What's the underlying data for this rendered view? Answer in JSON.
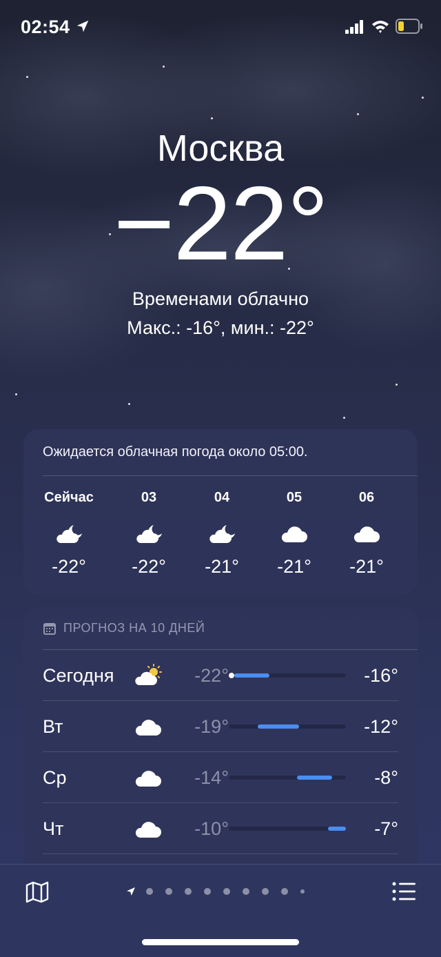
{
  "status_bar": {
    "time": "02:54",
    "icons": [
      "location-arrow-icon",
      "signal-bars-icon",
      "wifi-icon",
      "battery-low-icon"
    ],
    "battery_color": "#f5d130"
  },
  "current": {
    "city": "Москва",
    "temperature": "−22°",
    "condition": "Временами облачно",
    "hi_lo": "Макс.: -16°, мин.: -22°"
  },
  "hourly": {
    "note": "Ожидается облачная погода около 05:00.",
    "items": [
      {
        "label": "Сейчас",
        "icon": "cloud-moon-icon",
        "temp": "-22°"
      },
      {
        "label": "03",
        "icon": "cloud-moon-icon",
        "temp": "-22°"
      },
      {
        "label": "04",
        "icon": "cloud-moon-icon",
        "temp": "-21°"
      },
      {
        "label": "05",
        "icon": "cloud-icon",
        "temp": "-21°"
      },
      {
        "label": "06",
        "icon": "cloud-icon",
        "temp": "-21°"
      }
    ]
  },
  "daily": {
    "header": "ПРОГНОЗ НА 10 ДНЕЙ",
    "range_min": -22,
    "range_max": -7,
    "rows": [
      {
        "day": "Сегодня",
        "icon": "cloud-sun-icon",
        "lo": "-22°",
        "hi": "-16°",
        "lo_val": -22,
        "hi_val": -16,
        "current_val": -22
      },
      {
        "day": "Вт",
        "icon": "cloud-icon",
        "lo": "-19°",
        "hi": "-12°",
        "lo_val": -19,
        "hi_val": -12
      },
      {
        "day": "Ср",
        "icon": "cloud-icon",
        "lo": "-14°",
        "hi": "-8°",
        "lo_val": -14,
        "hi_val": -8
      },
      {
        "day": "Чт",
        "icon": "cloud-icon",
        "lo": "-10°",
        "hi": "-7°",
        "lo_val": -10,
        "hi_val": -7
      }
    ]
  },
  "bottom_bar": {
    "map_icon": "map-icon",
    "list_icon": "list-icon",
    "page_count": 9,
    "current_page_icon": "location-arrow-icon"
  },
  "colors": {
    "bar_fill": "#4a8ef0",
    "sun": "#f5c842"
  }
}
